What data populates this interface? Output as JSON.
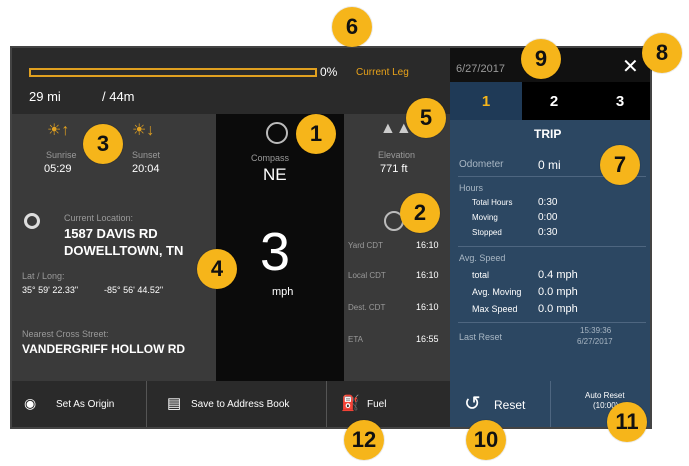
{
  "header": {
    "date": "6/27/2017",
    "close_label": "✕",
    "progress_percent_label": "0%",
    "progress_value": 0,
    "current_leg_label": "Current Leg",
    "distance_done": "29 mi",
    "distance_total": "/ 44m"
  },
  "sun": {
    "sunrise_label": "Sunrise",
    "sunrise_time": "05:29",
    "sunset_label": "Sunset",
    "sunset_time": "20:04"
  },
  "compass": {
    "label": "Compass",
    "value": "NE"
  },
  "elevation": {
    "label": "Elevation",
    "value": "771 ft"
  },
  "location": {
    "current_label": "Current Location:",
    "line1": "1587 DAVIS RD",
    "line2": "DOWELLTOWN, TN",
    "latlong_label": "Lat / Long:",
    "lat": "35° 59' 22.33\"",
    "long": "-85° 56' 44.52\"",
    "cross_label": "Nearest Cross Street:",
    "cross_value": "VANDERGRIFF HOLLOW RD"
  },
  "speed": {
    "value": "3",
    "unit": "mph"
  },
  "times": [
    {
      "label": "Yard CDT",
      "value": "16:10"
    },
    {
      "label": "Local CDT",
      "value": "16:10"
    },
    {
      "label": "Dest. CDT",
      "value": "16:10"
    },
    {
      "label": "ETA",
      "value": "16:55"
    }
  ],
  "trip": {
    "tabs": [
      "1",
      "2",
      "3"
    ],
    "title": "TRIP",
    "odometer_label": "Odometer",
    "odometer_value": "0 mi",
    "hours_label": "Hours",
    "hours": [
      {
        "label": "Total Hours",
        "value": "0:30"
      },
      {
        "label": "Moving",
        "value": "0:00"
      },
      {
        "label": "Stopped",
        "value": "0:30"
      }
    ],
    "avg_label": "Avg. Speed",
    "avg": [
      {
        "label": "total",
        "value": "0.4 mph"
      },
      {
        "label": "Avg. Moving",
        "value": "0.0 mph"
      },
      {
        "label": "Max Speed",
        "value": "0.0 mph"
      }
    ],
    "last_reset_label": "Last Reset",
    "last_reset_time": "15:39:36",
    "last_reset_date": "6/27/2017"
  },
  "bottom": {
    "set_origin": "Set As Origin",
    "save_address": "Save to Address Book",
    "fuel": "Fuel",
    "reset": "Reset",
    "auto_reset_line1": "Auto Reset",
    "auto_reset_line2": "(10:00)"
  },
  "callouts": [
    "1",
    "2",
    "3",
    "4",
    "5",
    "6",
    "7",
    "8",
    "9",
    "10",
    "11",
    "12"
  ],
  "colors": {
    "accent": "#f6b51a",
    "tab_blue": "#1f3a57",
    "panel_blue": "#2c4762"
  }
}
